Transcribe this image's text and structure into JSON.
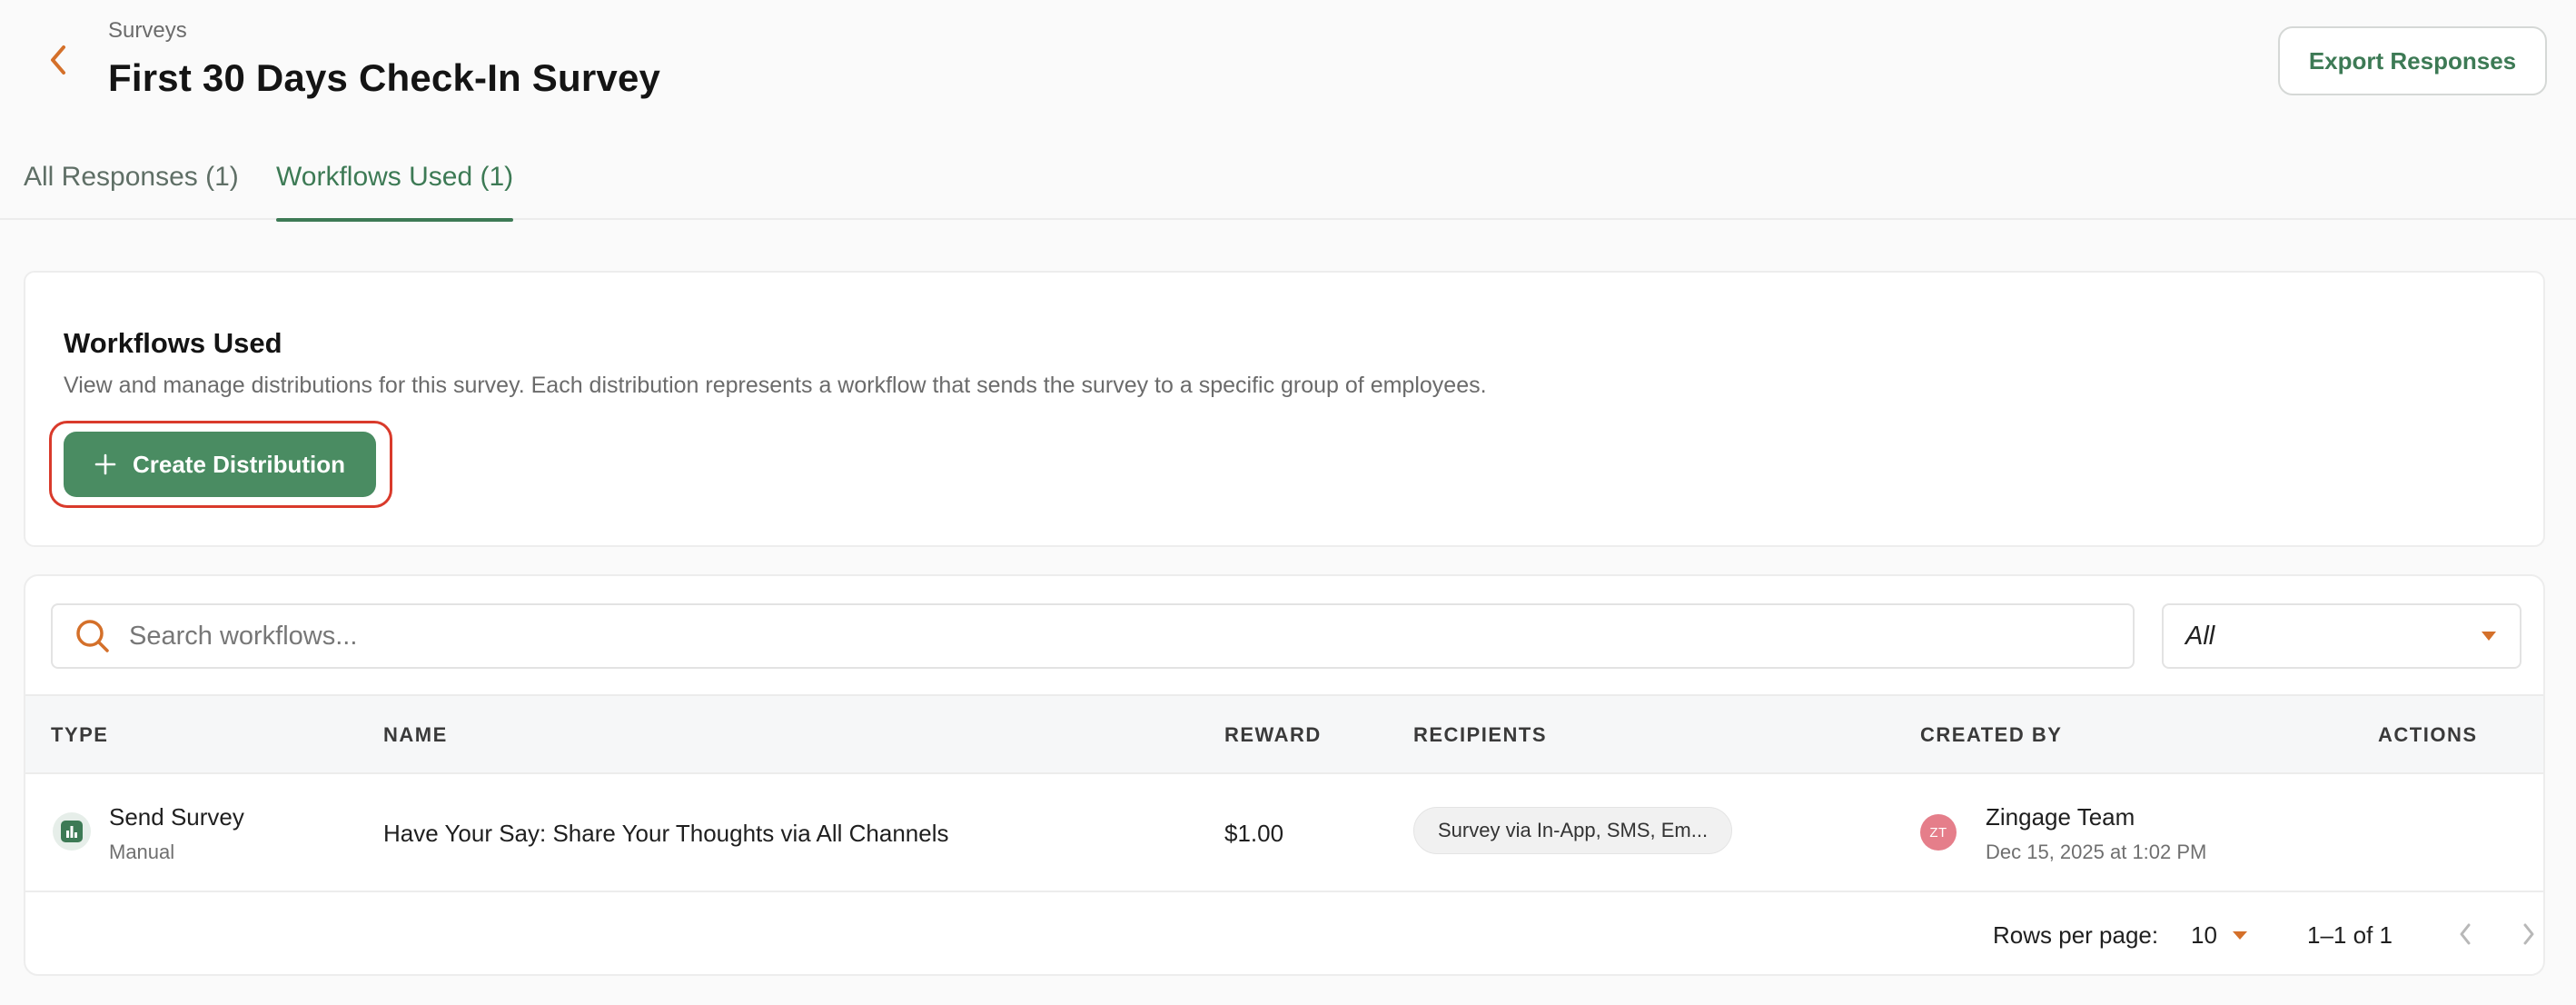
{
  "header": {
    "breadcrumb": "Surveys",
    "title": "First 30 Days Check-In Survey",
    "export_label": "Export Responses"
  },
  "tabs": [
    {
      "label": "All Responses (1)",
      "active": false
    },
    {
      "label": "Workflows Used (1)",
      "active": true
    }
  ],
  "info_card": {
    "title": "Workflows Used",
    "description": "View and manage distributions for this survey. Each distribution represents a workflow that sends the survey to a specific group of employees.",
    "create_label": "Create Distribution"
  },
  "search": {
    "placeholder": "Search workflows...",
    "value": ""
  },
  "filter": {
    "selected": "All"
  },
  "table": {
    "columns": [
      "TYPE",
      "NAME",
      "REWARD",
      "RECIPIENTS",
      "CREATED BY",
      "ACTIONS"
    ],
    "rows": [
      {
        "type": "Send Survey",
        "type_sub": "Manual",
        "type_icon": "bar-chart-icon",
        "name": "Have Your Say: Share Your Thoughts via All Channels",
        "reward": "$1.00",
        "recipients": "Survey via In-App, SMS, Em...",
        "creator_initials": "ZT",
        "creator_name": "Zingage Team",
        "created_at": "Dec 15, 2025 at 1:02 PM"
      }
    ]
  },
  "pagination": {
    "rows_per_page_label": "Rows per page:",
    "rows_per_page": "10",
    "range": "1–1 of 1"
  },
  "colors": {
    "accent_green": "#3d7a55",
    "button_green": "#4a8c62",
    "accent_orange": "#d4702a",
    "highlight_red": "#d93a2b",
    "avatar_pink": "#e57e8a"
  }
}
